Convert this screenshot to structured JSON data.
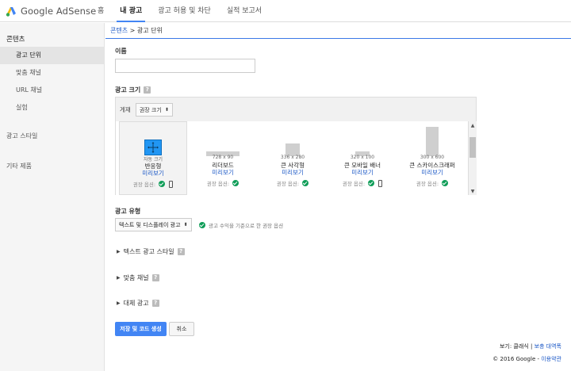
{
  "brand": {
    "name": "Google AdSense"
  },
  "topnav": [
    "홈",
    "내 광고",
    "광고 허용 및 차단",
    "실적 보고서"
  ],
  "topnav_active": "내 광고",
  "sidebar": {
    "header": "콘텐츠",
    "items": [
      "광고 단위",
      "맞춤 채널",
      "URL 채널",
      "실험"
    ],
    "sections": [
      "광고 스타일",
      "기타 제품"
    ]
  },
  "breadcrumb": {
    "parent": "콘텐츠",
    "sep": " > ",
    "current": "광고 단위"
  },
  "form": {
    "name_label": "이름",
    "name_value": "",
    "size_label": "광고 크기",
    "help": "?",
    "filter_label": "게재",
    "filter_value": "권장 크기",
    "ad_sizes": [
      {
        "dims": "자동 크기",
        "name": "반응형",
        "preview": "미리보기",
        "rec": "권장 옵션:",
        "mobile": true
      },
      {
        "dims": "728 x 90",
        "name": "리더보드",
        "preview": "미리보기",
        "rec": "권장 옵션:",
        "mobile": false
      },
      {
        "dims": "336 x 280",
        "name": "큰 사각형",
        "preview": "미리보기",
        "rec": "권장 옵션:",
        "mobile": false
      },
      {
        "dims": "320 x 100",
        "name": "큰 모바일 배너",
        "preview": "미리보기",
        "rec": "권장 옵션:",
        "mobile": true
      },
      {
        "dims": "300 x 600",
        "name": "큰 스카이스크래퍼",
        "preview": "미리보기",
        "rec": "권장 옵션:",
        "mobile": false
      }
    ],
    "type_label": "광고 유형",
    "type_value": "텍스트 및 디스플레이 광고",
    "type_note": "광고 수익을 기준으로 한 권장 옵션",
    "expanders": [
      "텍스트 광고 스타일",
      "맞춤 채널",
      "대체 광고"
    ],
    "save_button": "저장 및 코드 생성",
    "cancel_button": "취소"
  },
  "footer": {
    "view_prefix": "보기: ",
    "view_current": "클래식",
    "view_sep": " | ",
    "view_alt": "보충 대역폭",
    "copyright": "© 2016 Google",
    "terms_sep": " - ",
    "terms": "이용약관"
  },
  "colors": {
    "accent": "#4285f4",
    "link": "#1a57c6",
    "check": "#0f9d58"
  }
}
